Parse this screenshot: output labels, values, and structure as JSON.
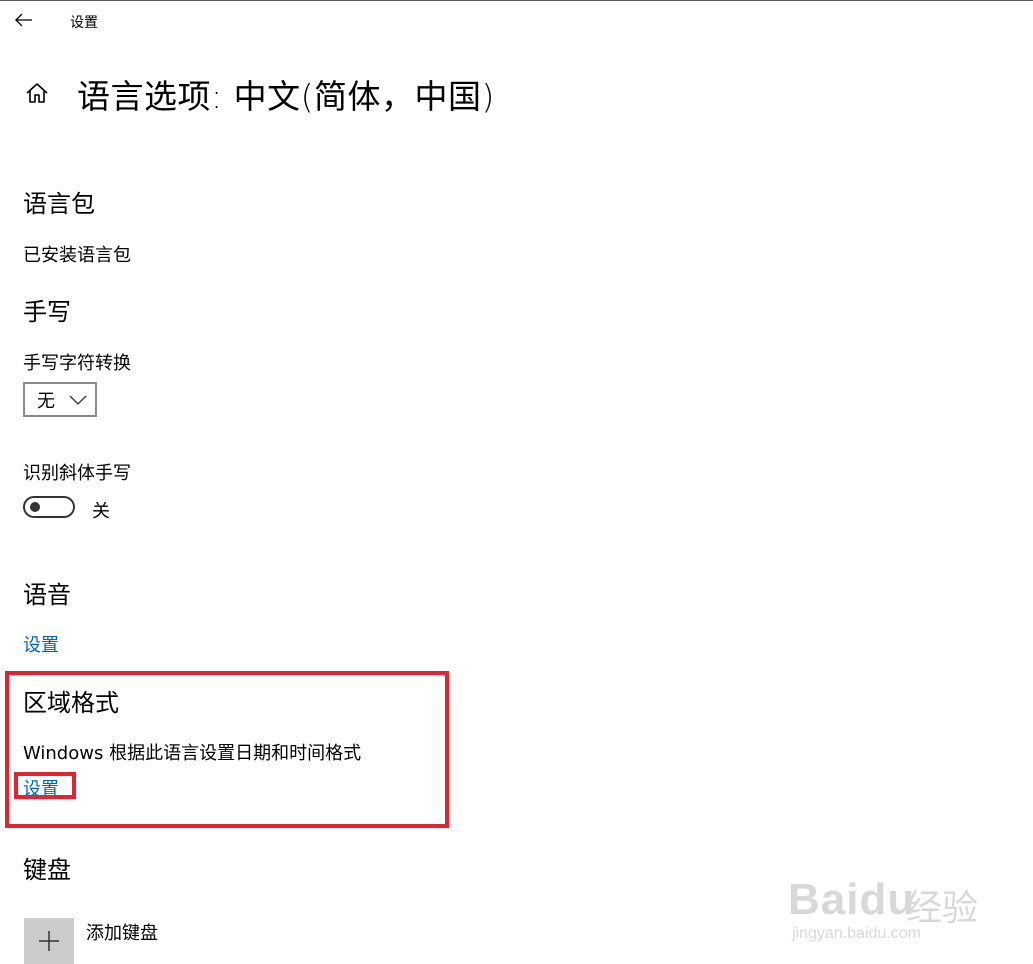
{
  "window": {
    "title": "设置"
  },
  "page": {
    "title": "语言选项: 中文(简体，中国)"
  },
  "sections": {
    "language_pack": {
      "heading": "语言包",
      "status": "已安装语言包"
    },
    "handwriting": {
      "heading": "手写",
      "conversion_label": "手写字符转换",
      "conversion_value": "无",
      "italic_label": "识别斜体手写",
      "italic_state": "关",
      "italic_on": false
    },
    "speech": {
      "heading": "语音",
      "link": "设置"
    },
    "regional_format": {
      "heading": "区域格式",
      "description": "Windows 根据此语言设置日期和时间格式",
      "link": "设置"
    },
    "keyboard": {
      "heading": "键盘",
      "add_label": "添加键盘"
    }
  },
  "watermark": {
    "brand": "Baidu",
    "brand_cn": "经验",
    "url": "jingyan.baidu.com"
  },
  "colors": {
    "link": "#0067c0",
    "highlight": "#e1242f",
    "tile": "#cccccc"
  },
  "icons": [
    "back-arrow-icon",
    "home-icon",
    "chevron-down-icon",
    "plus-icon"
  ]
}
